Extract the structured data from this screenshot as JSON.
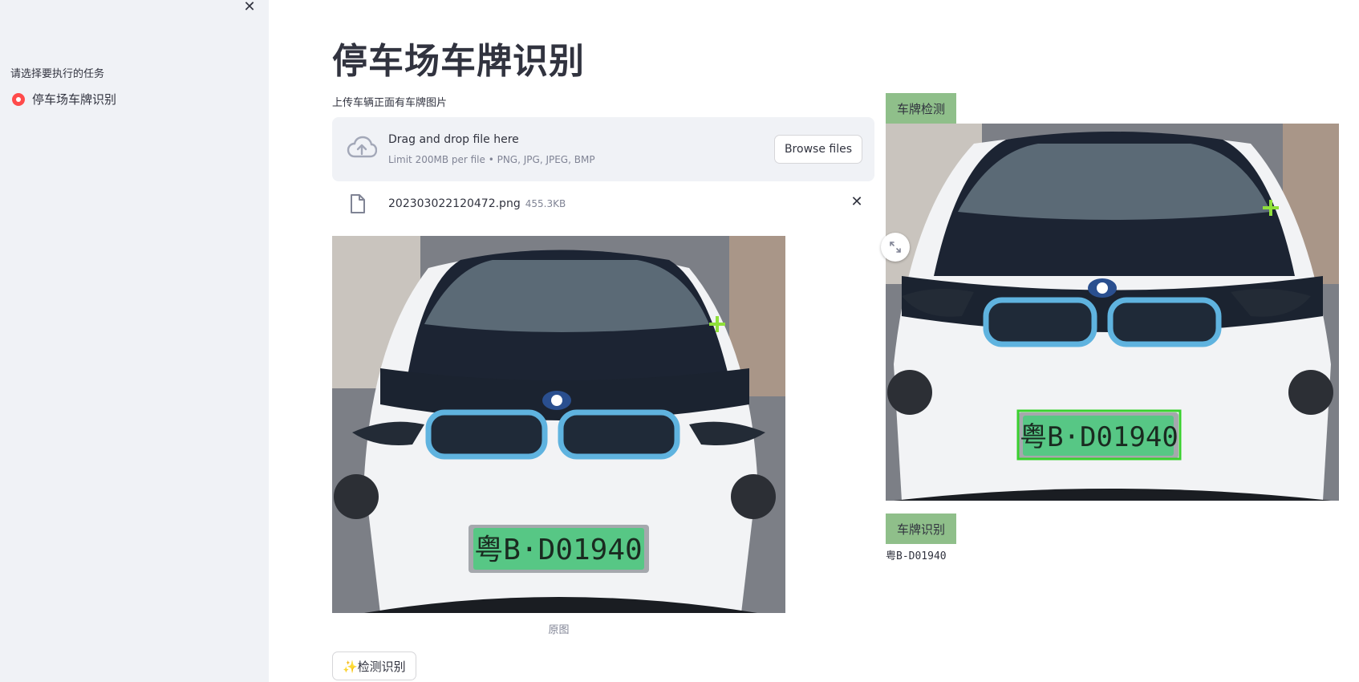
{
  "sidebar": {
    "close_label": "✕",
    "task_label": "请选择要执行的任务",
    "options": [
      {
        "label": "停车场车牌识别",
        "selected": true
      }
    ]
  },
  "main": {
    "title": "停车场车牌识别",
    "upload_label": "上传车辆正面有车牌图片",
    "dropzone": {
      "title": "Drag and drop file here",
      "limit": "Limit 200MB per file • PNG, JPG, JPEG, BMP",
      "browse_label": "Browse files"
    },
    "file": {
      "name": "202303022120472.png",
      "size": "455.3KB"
    },
    "original_caption": "原图",
    "detect_button": "✨检测识别",
    "detect_tag": "车牌检测",
    "recognize_tag": "车牌识别",
    "plate_text": "粤B-D01940",
    "plate_display": "粤B·D01940"
  },
  "colors": {
    "sidebar_bg": "#f0f2f6",
    "accent": "#ff4b4b",
    "tag_bg": "#8fbf8a",
    "plate_green": "#57c785",
    "detect_box": "#39d12e"
  },
  "icons": {
    "upload": "cloud-upload-icon",
    "file": "file-icon",
    "close": "close-icon",
    "fullscreen": "fullscreen-icon"
  }
}
